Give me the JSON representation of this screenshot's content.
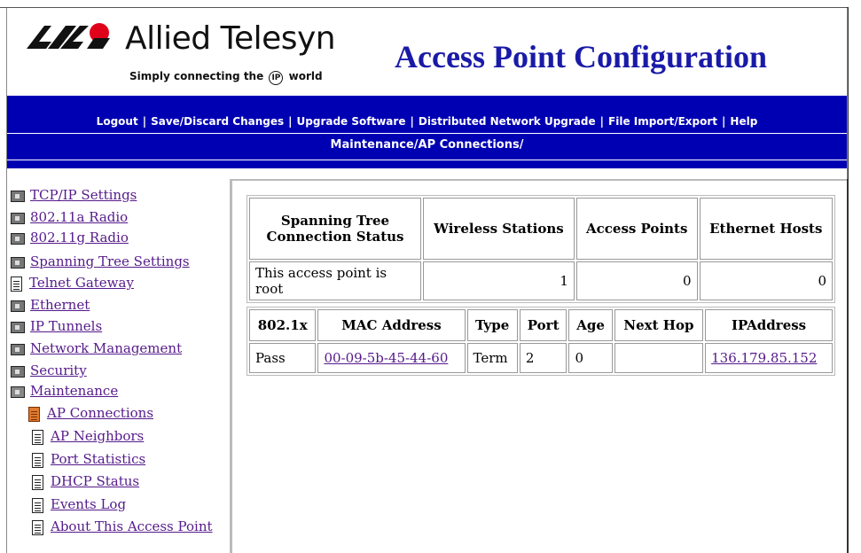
{
  "header": {
    "brand": "Allied Telesyn",
    "tagline_before": "Simply connecting the",
    "tagline_ip": "IP",
    "tagline_after": "world",
    "title": "Access Point Configuration"
  },
  "nav": {
    "items": [
      "Logout",
      "Save/Discard Changes",
      "Upgrade Software",
      "Distributed Network Upgrade",
      "File Import/Export",
      "Help"
    ],
    "separator": "|"
  },
  "breadcrumb": "Maintenance/AP Connections/",
  "sidebar": {
    "items": [
      {
        "label": "TCP/IP Settings",
        "icon": "folder-icon"
      },
      {
        "label": "802.11a Radio",
        "icon": "folder-icon"
      },
      {
        "label": "802.11g Radio",
        "icon": "folder-icon"
      },
      {
        "label": "Spanning Tree Settings",
        "icon": "folder-icon"
      },
      {
        "label": "Telnet Gateway",
        "icon": "document-icon"
      },
      {
        "label": "Ethernet",
        "icon": "folder-icon"
      },
      {
        "label": "IP Tunnels",
        "icon": "folder-icon"
      },
      {
        "label": "Network Management",
        "icon": "folder-icon"
      },
      {
        "label": "Security",
        "icon": "folder-icon"
      },
      {
        "label": "Maintenance",
        "icon": "open-folder-icon"
      },
      {
        "label": "AP Connections",
        "icon": "active-document-icon"
      },
      {
        "label": "AP Neighbors",
        "icon": "document-icon"
      },
      {
        "label": "Port Statistics",
        "icon": "document-icon"
      },
      {
        "label": "DHCP Status",
        "icon": "document-icon"
      },
      {
        "label": "Events Log",
        "icon": "document-icon"
      },
      {
        "label": "About This Access Point",
        "icon": "document-icon"
      }
    ]
  },
  "summary_table": {
    "headers": [
      "Spanning Tree Connection Status",
      "Wireless Stations",
      "Access Points",
      "Ethernet Hosts"
    ],
    "row": [
      "This access point is root",
      "1",
      "0",
      "0"
    ]
  },
  "connections_table": {
    "headers": [
      "802.1x",
      "MAC Address",
      "Type",
      "Port",
      "Age",
      "Next Hop",
      "IPAddress"
    ],
    "rows": [
      [
        "Pass",
        "00-09-5b-45-44-60",
        "Term",
        "2",
        "0",
        "",
        "136.179.85.152"
      ]
    ]
  },
  "colors": {
    "nav_bar": "#0000b3",
    "title": "#1a1aa8",
    "visited_link": "#551a8b",
    "logo_red": "#e0001a"
  }
}
